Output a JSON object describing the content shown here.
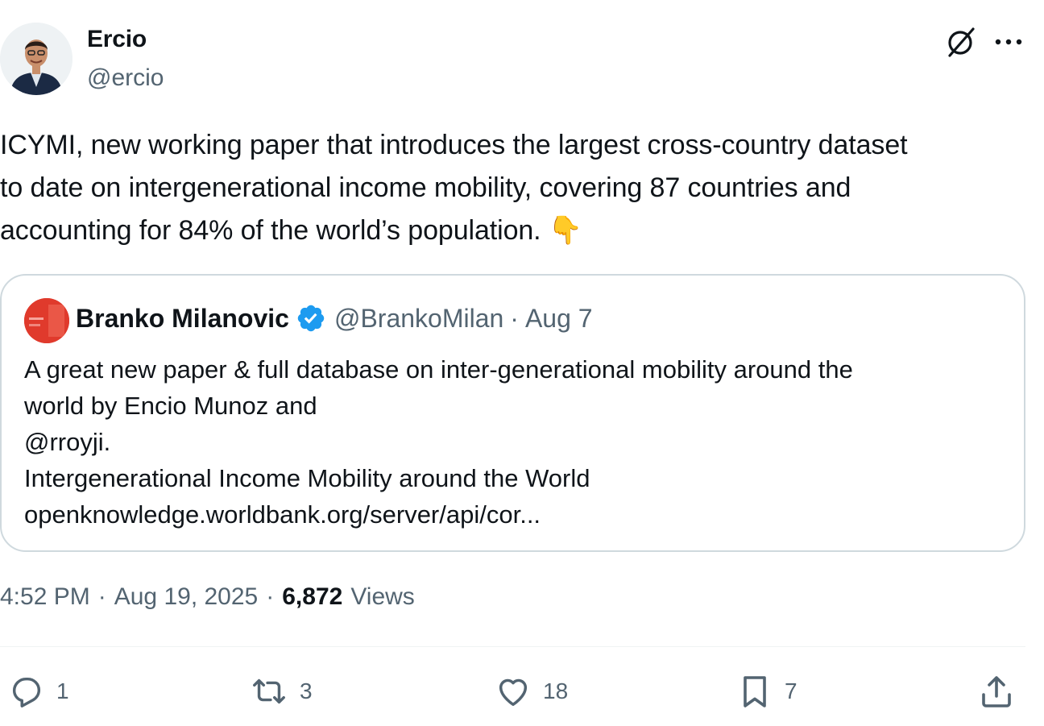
{
  "author": {
    "name": "Ercio",
    "handle": "@ercio"
  },
  "header_icons": [
    "grok-icon",
    "more-icon"
  ],
  "tweet": {
    "lines": [
      "ICYMI, new working paper that introduces the largest cross-country dataset",
      "to date on intergenerational income mobility, covering 87 countries and",
      "accounting for 84% of the world’s population."
    ],
    "emoji": "👇"
  },
  "quote": {
    "name": "Branko Milanovic",
    "verified": true,
    "handle": "@BrankoMilan",
    "separator": "·",
    "date": "Aug 7",
    "lines": [
      "A great new paper & full database on inter-generational mobility around the",
      "world by Encio Munoz and",
      "@rroyji.",
      "Intergenerational Income Mobility around the World",
      "openknowledge.worldbank.org/server/api/cor..."
    ],
    "avatar_color": "#e03a2c"
  },
  "meta": {
    "time": "4:52 PM",
    "separator": "·",
    "date": "Aug 19, 2025",
    "views_count": "6,872",
    "views_label": "Views"
  },
  "actions": {
    "replies": "1",
    "reposts": "3",
    "likes": "18",
    "bookmarks": "7"
  },
  "colors": {
    "text": "#0f1419",
    "secondary": "#536471",
    "border": "#cfd9de",
    "verified": "#1d9bf0"
  }
}
